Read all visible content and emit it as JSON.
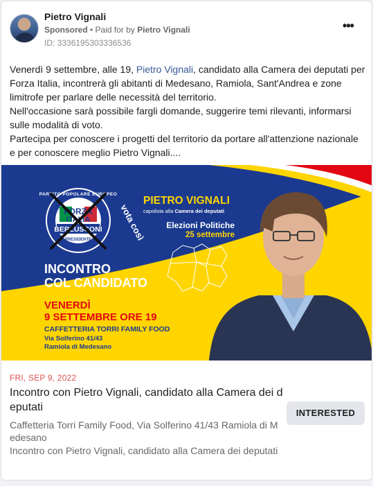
{
  "post": {
    "page_name": "Pietro Vignali",
    "sponsored_label": "Sponsored",
    "separator": " • ",
    "paid_for_text": "Paid for by ",
    "paid_for_name": "Pietro Vignali",
    "ad_id": "ID: 3336195303336536",
    "more_label": "•••"
  },
  "body": {
    "p1_before_link": "Venerdì 9 settembre, alle 19, ",
    "p1_link": "Pietro Vignali",
    "p1_after_link": ", candidato alla Camera dei deputati per Forza Italia, incontrerà gli abitanti di Medesano, Ramiola, Sant'Andrea e zone limitrofe per parlare delle necessità del territorio.",
    "p2": "Nell'occasione sarà possibile fargli domande, suggerire temi rilevanti, informarsi sulle modalità di voto.",
    "p3": "Partecipa per conoscere i progetti del territorio da portare all'attenzione nazionale e per conoscere meglio Pietro Vignali...."
  },
  "banner": {
    "logo_ring_top": "PARTITO POPOLARE EUROPEO",
    "logo_forza": "FORZA",
    "logo_italia": "ITALIA",
    "logo_berlusconi": "BERLUSCONI",
    "logo_presidente": "PRESIDENTE",
    "vota_cosi": "vota così",
    "candidate_name": "PIETRO VIGNALI",
    "capolista_prefix": "capolista alla ",
    "capolista_bold": "Camera dei deputati",
    "elezioni": "Elezioni Politiche",
    "election_date": "25 settembre",
    "incontro_line1": "INCONTRO",
    "incontro_line2": "COL CANDIDATO",
    "venerdi": "VENERDÌ",
    "date_time": "9 SETTEMBRE ORE 19",
    "venue": "CAFFETTERIA TORRI FAMILY FOOD",
    "street": "Via Solferino 41/43",
    "town": "Ramiola di Medesano",
    "colors": {
      "navy": "#1b3a8f",
      "yellow": "#ffd500",
      "red": "#e30613"
    }
  },
  "event": {
    "date": "FRI, SEP 9, 2022",
    "title": "Incontro con Pietro Vignali, candidato alla Camera dei deputati",
    "location": "Caffetteria Torri Family Food, Via Solferino 41/43 Ramiola di Medesano",
    "description": "Incontro con Pietro Vignali, candidato alla Camera dei deputati",
    "interested_label": "INTERESTED"
  }
}
